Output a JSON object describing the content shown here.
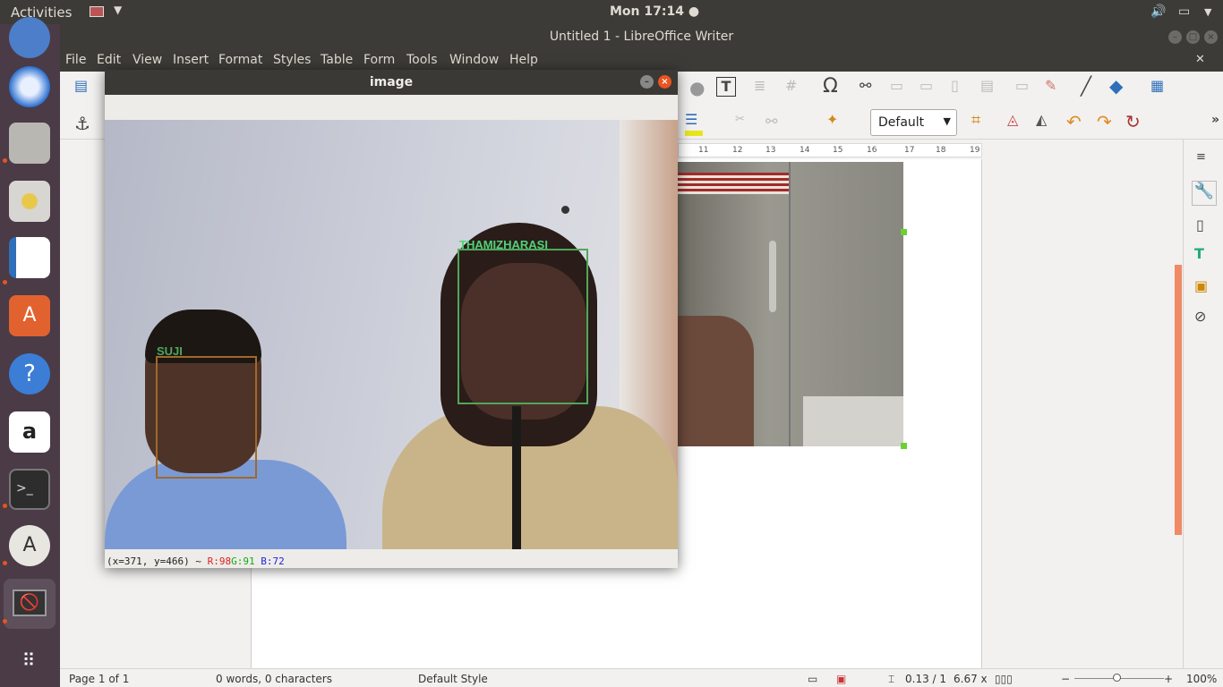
{
  "topbar": {
    "activities": "Activities",
    "clock": "Mon 17:14 ●"
  },
  "window": {
    "title": "Untitled 1 - LibreOffice Writer"
  },
  "menu": {
    "items": [
      "File",
      "Edit",
      "View",
      "Insert",
      "Format",
      "Styles",
      "Table",
      "Form",
      "Tools",
      "Window",
      "Help"
    ]
  },
  "toolbar": {
    "frame_style": "Default"
  },
  "ruler": {
    "ticks": [
      "11",
      "12",
      "13",
      "14",
      "15",
      "16",
      "17",
      "18",
      "19"
    ]
  },
  "image_window": {
    "title": "image",
    "pixel_info": {
      "coords": "(x=371, y=466) ~",
      "r": "R:98",
      "g": "G:91",
      "b": "B:72"
    },
    "faces": [
      {
        "name": "SUJI",
        "color": "#a0692a"
      },
      {
        "name": "THAMIZHARASI",
        "color": "#4fa85a"
      }
    ]
  },
  "statusbar": {
    "page": "Page 1 of 1",
    "words": "0 words, 0 characters",
    "style": "Default Style",
    "position": "0.13 / 1",
    "size": "6.67 x",
    "zoom": "100%"
  },
  "launcher": {
    "icons": [
      "chromium-icon",
      "thunderbird-icon",
      "files-icon",
      "rhythmbox-icon",
      "writer-icon",
      "software-center-icon",
      "help-icon",
      "amazon-icon",
      "terminal-icon",
      "software-updater-icon",
      "blocked-app-icon",
      "show-apps-icon"
    ]
  }
}
